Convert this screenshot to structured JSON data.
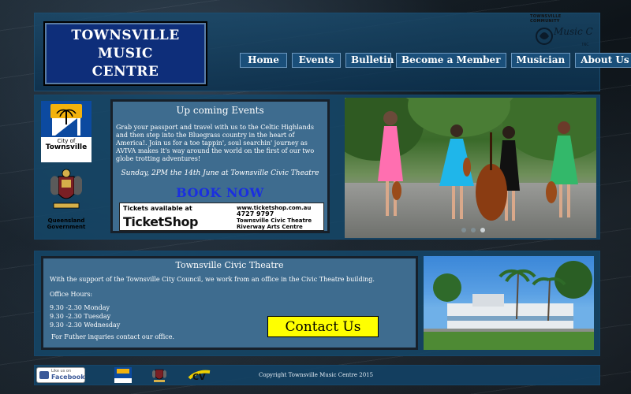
{
  "site": {
    "name": "TOWNSVILLE MUSIC CENTRE",
    "name_line1": "TOWNSVILLE MUSIC",
    "name_line2": "CENTRE",
    "brand_small": "TOWNSVILLE COMMUNITY",
    "brand_script": "Music Centre",
    "brand_suffix": "INC"
  },
  "nav": {
    "items": [
      "Home",
      "Events",
      "Bulletin",
      "Become a Member",
      "Musician",
      "About Us"
    ]
  },
  "logos": {
    "city": {
      "line1": "City of",
      "line2": "Townsville"
    },
    "qld": {
      "line1": "Queensland",
      "line2": "Government"
    }
  },
  "events": {
    "title": "Up coming Events",
    "description": "Grab your passport and travel with us to the Celtic Highlands and then step into the Bluegrass country in the heart of America!. Join us for a toe tappin', soul searchin' journey as AVIVA makes it's way around the world on the first of our two globe trotting adventures!",
    "date": "Sunday, 2PM the 14th June at Townsville Civic Theatre",
    "book_label": "BOOK NOW",
    "ticket": {
      "available": "Tickets available at",
      "brand": "TicketShop",
      "url": "www.ticketshop.com.au",
      "phone": "4727 9797",
      "venue1": "Townsville Civic Theatre",
      "venue2": "Riverway Arts Centre"
    }
  },
  "slider": {
    "current": 3,
    "count": 3
  },
  "theatre": {
    "title": "Townsville Civic Theatre",
    "intro": "With the support of the Townsville City Council, we work from an office in the Civic Theatre building.",
    "hours_label": "Office Hours:",
    "hours": [
      "9.30 -2.30 Monday",
      "9.30 -2.30 Tuesday",
      "9.30 -2.30 Wednesday"
    ],
    "inquiries": "For Futher inquries contact our office.",
    "contact_label": "Contact Us"
  },
  "footer": {
    "fb_small": "Like us on",
    "fb_label": "Facebook",
    "copyright": "Copyright Townsville Music Centre 2015"
  },
  "colors": {
    "accent_blue": "#1a4f7a",
    "book_blue": "#1a2fe0",
    "contact_yellow": "#ffff00",
    "logo_navy": "#0e2e7a"
  }
}
